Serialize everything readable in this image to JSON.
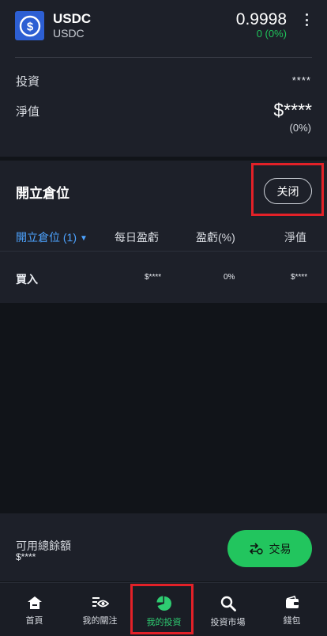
{
  "header": {
    "coin_name": "USDC",
    "coin_sub": "USDC",
    "price": "0.9998",
    "change": "0 (0%)",
    "invest_label": "投資",
    "invest_value": "****",
    "nav_label": "淨值",
    "nav_value": "$****",
    "nav_pct": "(0%)",
    "colors": {
      "change_positive": "#1fc35a",
      "coin_logo": "#2d5fd3"
    },
    "icons": [
      "usdc-logo-icon",
      "more-vertical-icon"
    ]
  },
  "positions": {
    "title": "開立倉位",
    "close_label": "关闭",
    "columns": {
      "positions": "開立倉位 (1)",
      "daily_pl": "每日盈虧",
      "pl_pct": "盈虧(%)",
      "nav": "淨值"
    },
    "rows": [
      {
        "side": "買入",
        "daily_pl": "$****",
        "pl_pct": "0%",
        "nav": "$****"
      }
    ]
  },
  "tradebar": {
    "available_label": "可用總餘額",
    "available_value": "$****",
    "trade_label": "交易",
    "color": "#22c55e"
  },
  "tabs": [
    {
      "label": "首頁",
      "icon": "home-icon"
    },
    {
      "label": "我的關注",
      "icon": "watchlist-eye-icon"
    },
    {
      "label": "我的投資",
      "icon": "pie-chart-icon",
      "active": true
    },
    {
      "label": "投資市場",
      "icon": "search-icon"
    },
    {
      "label": "錢包",
      "icon": "wallet-icon"
    }
  ]
}
